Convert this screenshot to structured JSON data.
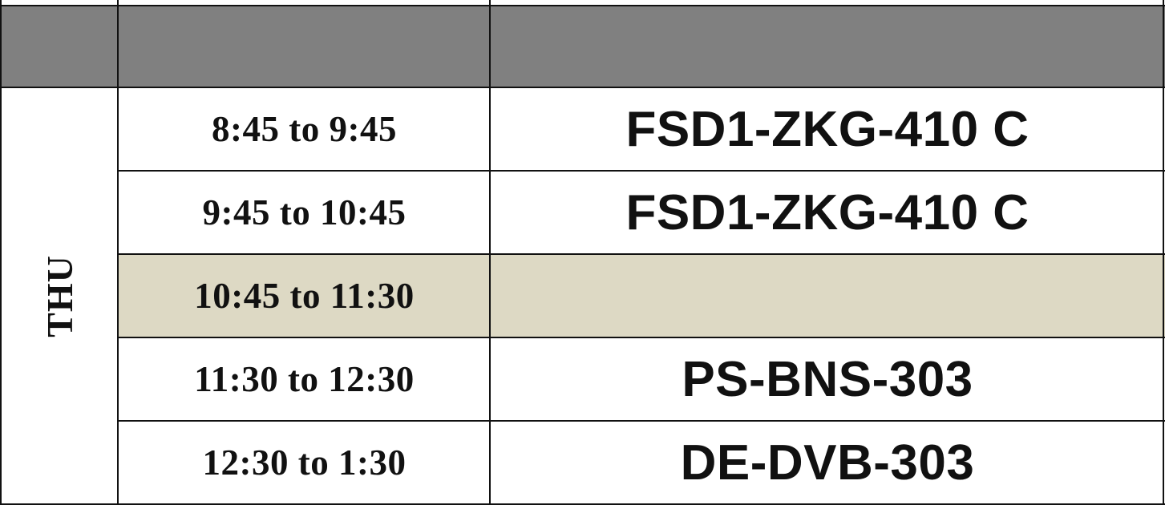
{
  "table": {
    "header_fill": "#808080",
    "break_fill": "#ddd9c4",
    "day": "THU",
    "rows": [
      {
        "time": "8:45 to 9:45",
        "course": "FSD1-ZKG-410 C"
      },
      {
        "time": "9:45 to 10:45",
        "course": "FSD1-ZKG-410 C"
      },
      {
        "time": "10:45 to 11:30",
        "course": ""
      },
      {
        "time": "11:30 to 12:30",
        "course": "PS-BNS-303"
      },
      {
        "time": "12:30 to 1:30",
        "course": "DE-DVB-303"
      }
    ]
  }
}
